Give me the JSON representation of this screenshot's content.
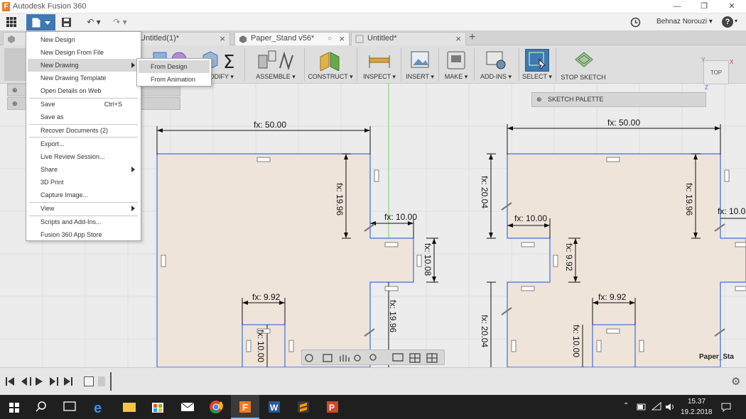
{
  "window": {
    "title": "Autodesk Fusion 360",
    "logo_letter": "F"
  },
  "appbar": {
    "user": "Behnaz Norouzi",
    "help": "?"
  },
  "tabs": [
    {
      "label": "Untitled(1)*"
    },
    {
      "label": "Paper_Stand v56*"
    },
    {
      "label": "Untitled*"
    }
  ],
  "toolbar": {
    "modify": "MODIFY",
    "assemble": "ASSEMBLE",
    "construct": "CONSTRUCT",
    "inspect": "INSPECT",
    "insert": "INSERT",
    "make": "MAKE",
    "addins": "ADD-INS",
    "select": "SELECT",
    "stop_sketch": "STOP SKETCH"
  },
  "file_menu": {
    "new_design": "New Design",
    "new_design_from_file": "New Design From File",
    "new_drawing": "New Drawing",
    "new_drawing_template": "New Drawing Template",
    "open_details": "Open Details on Web",
    "save": "Save",
    "save_shortcut": "Ctrl+S",
    "save_as": "Save as",
    "recover": "Recover Documents (2)",
    "export": "Export...",
    "live_review": "Live Review Session...",
    "share": "Share",
    "print3d": "3D Print",
    "capture": "Capture Image...",
    "view": "View",
    "scripts": "Scripts and Add-Ins...",
    "app_store": "Fusion 360 App Store"
  },
  "submenu": {
    "from_design": "From Design",
    "from_animation": "From Animation"
  },
  "sketch_palette": "SKETCH PALETTE",
  "viewcube": {
    "face": "TOP",
    "x": "X",
    "y": "Y",
    "z": "Z"
  },
  "dimensions": {
    "w_left": "fx: 50.00",
    "w_right": "fx: 50.00",
    "h_left": "fx: 19.96",
    "h_right": "fx: 19.96",
    "notch_left": "fx: 10.00",
    "notch_right": "fx: 10.00",
    "notch_right_cut": "fx: 10.0",
    "h_notch_left": "fx: 10.08",
    "h_notch_right": "fx: 9.92",
    "h_lower_left": "fx: 19.96",
    "h_side_right_top": "fx: 20.04",
    "h_side_right_bot": "fx: 20.04",
    "slot_left": "fx: 9.92",
    "slot_right": "fx: 9.92",
    "slot_h_left": "fx: 10.00",
    "slot_h_right": "fx: 10.00"
  },
  "canvas_label": "Paper_Sta",
  "clock": {
    "time": "15.37",
    "date": "19.2.2018"
  },
  "colors": {
    "accent": "#3f78b3",
    "sketch_line": "#3c6fd6",
    "fill": "#efe4da"
  }
}
